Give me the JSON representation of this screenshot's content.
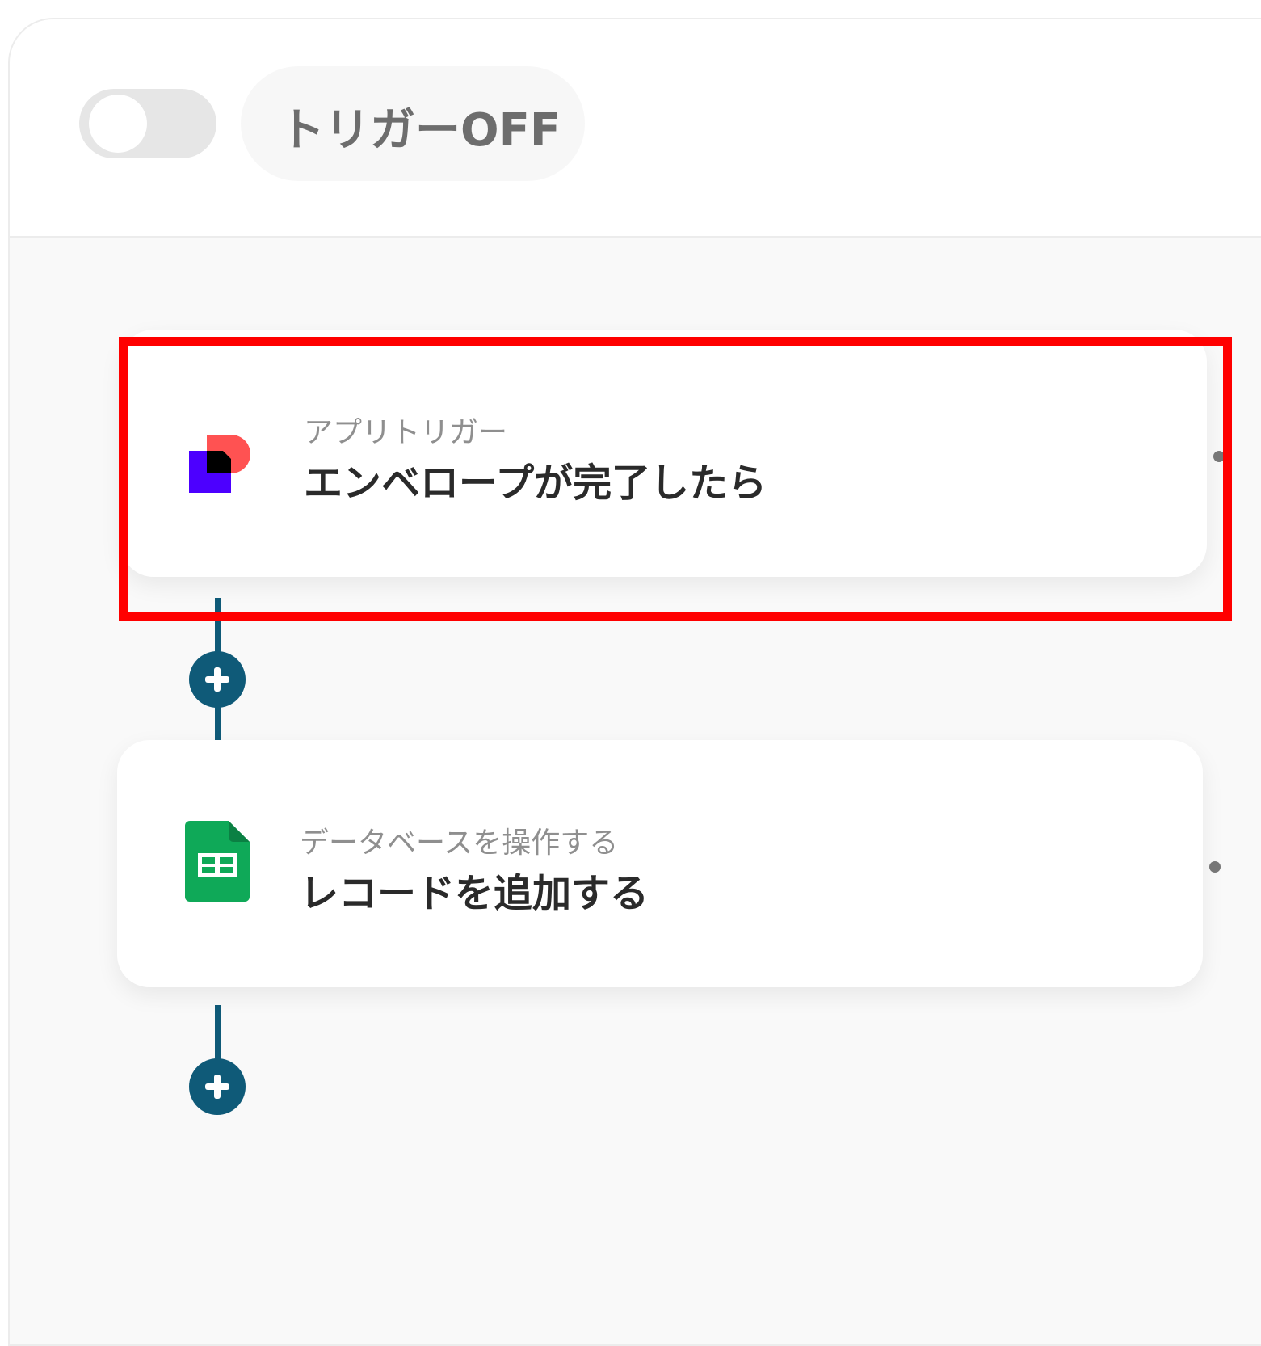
{
  "header": {
    "trigger_status_label": "トリガーOFF",
    "toggle_state": "off"
  },
  "flow": {
    "steps": [
      {
        "subtitle": "アプリトリガー",
        "title": "エンベロープが完了したら",
        "icon": "docusign-icon"
      },
      {
        "subtitle": "データベースを操作する",
        "title": "レコードを追加する",
        "icon": "google-sheets-icon"
      }
    ]
  },
  "colors": {
    "connector": "#0f5a78",
    "highlight_border": "#ff0000",
    "sheets_green": "#0fa958",
    "docusign_purple": "#4c00ff",
    "docusign_coral": "#ff5252"
  }
}
